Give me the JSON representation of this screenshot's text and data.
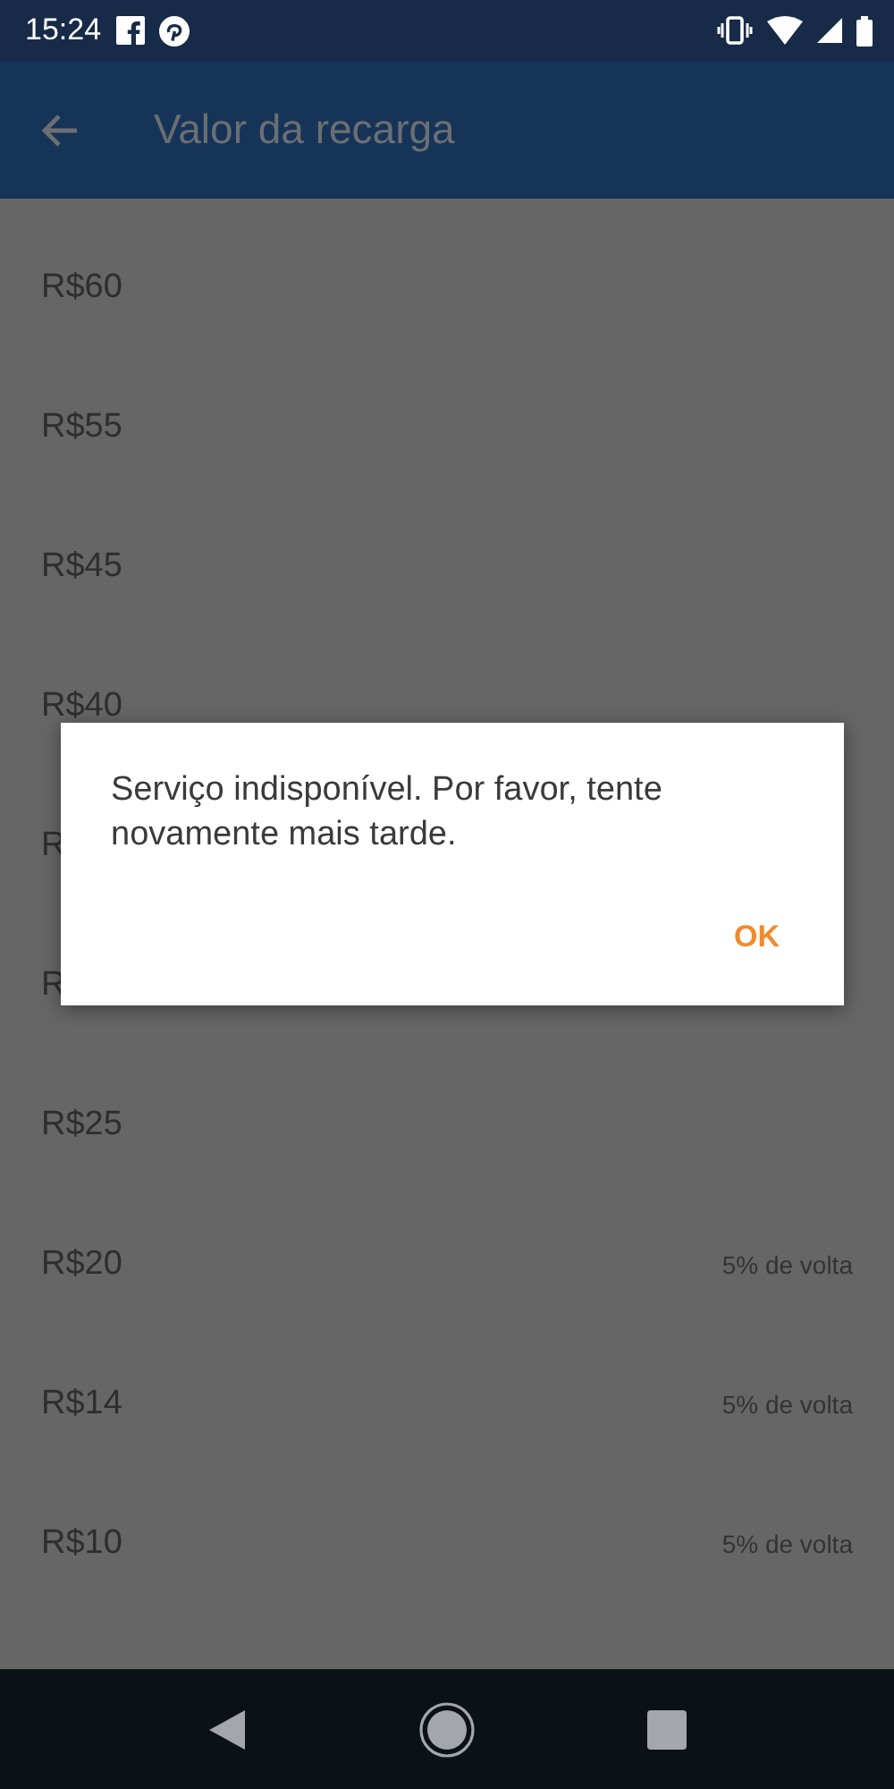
{
  "status_bar": {
    "time": "15:24"
  },
  "app_bar": {
    "title": "Valor da recarga"
  },
  "options": [
    {
      "amount": "R$60"
    },
    {
      "amount": "R$55"
    },
    {
      "amount": "R$45"
    },
    {
      "amount": "R$40"
    },
    {
      "amount": "R"
    },
    {
      "amount": "R"
    },
    {
      "amount": "R$25"
    },
    {
      "amount": "R$20",
      "cashback": "5% de volta"
    },
    {
      "amount": "R$14",
      "cashback": "5% de volta"
    },
    {
      "amount": "R$10",
      "cashback": "5% de volta"
    }
  ],
  "dialog": {
    "message": "Serviço indisponível. Por favor, tente novamente mais tarde.",
    "buttons": [
      "OK"
    ]
  }
}
